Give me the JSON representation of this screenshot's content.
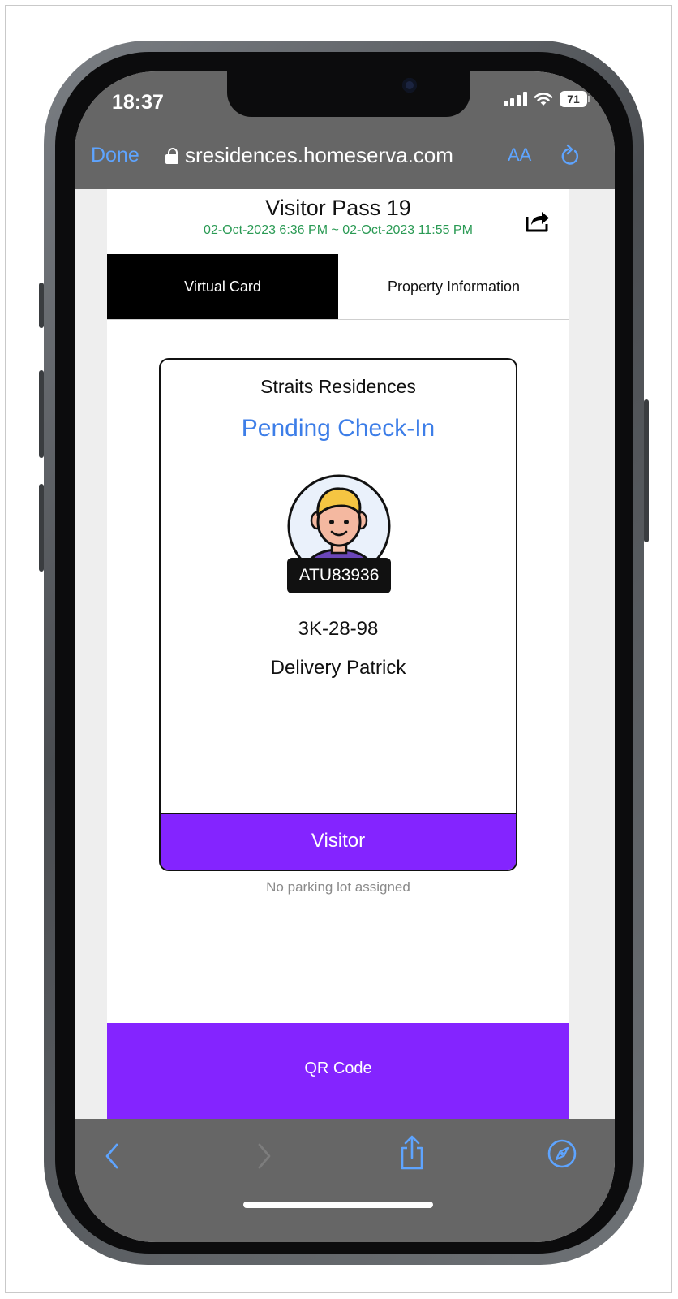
{
  "status_bar": {
    "time": "18:37",
    "battery": "71"
  },
  "browser": {
    "done_label": "Done",
    "url": "sresidences.homeserva.com",
    "text_size_label": "AA"
  },
  "header": {
    "title": "Visitor Pass 19",
    "dates": "02-Oct-2023 6:36 PM ~ 02-Oct-2023 11:55 PM"
  },
  "tabs": [
    {
      "label": "Virtual Card",
      "active": true
    },
    {
      "label": "Property Information",
      "active": false
    }
  ],
  "card": {
    "property": "Straits Residences",
    "status": "Pending Check-In",
    "pass_code": "ATU83936",
    "plate": "3K-28-98",
    "visitor_name": "Delivery Patrick",
    "category": "Visitor"
  },
  "parking_note": "No parking lot assigned",
  "qr_button_label": "QR Code",
  "colors": {
    "accent_purple": "#8424ff",
    "status_blue": "#3d7ee8",
    "date_green": "#2a9a54",
    "browser_link_blue": "#5ea4ff",
    "browser_chrome": "#666666"
  },
  "icons": {
    "lock": "lock-icon",
    "reload": "reload-icon",
    "share": "share-icon",
    "back": "chevron-left-icon",
    "forward": "chevron-right-icon",
    "compass": "compass-icon"
  }
}
